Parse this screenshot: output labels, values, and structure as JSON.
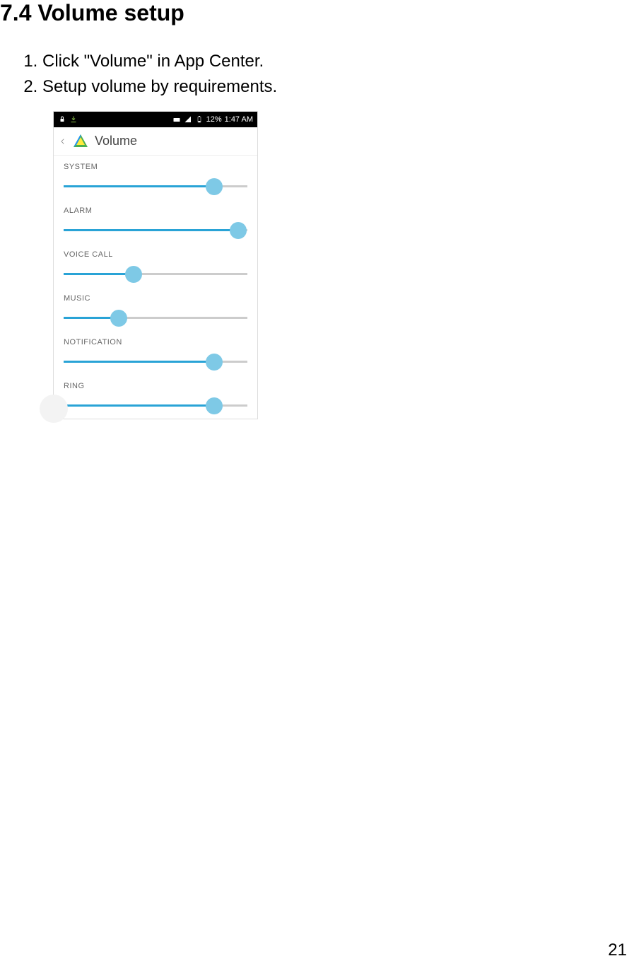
{
  "heading": "7.4 Volume setup",
  "steps": [
    "Click \"Volume\" in App Center.",
    "Setup volume by requirements."
  ],
  "screenshot": {
    "status_bar": {
      "battery_percent": "12%",
      "time": "1:47 AM"
    },
    "app_header": {
      "title": "Volume"
    },
    "sliders": [
      {
        "label": "SYSTEM",
        "percent": 82
      },
      {
        "label": "ALARM",
        "percent": 95
      },
      {
        "label": "VOICE CALL",
        "percent": 38
      },
      {
        "label": "MUSIC",
        "percent": 30
      },
      {
        "label": "NOTIFICATION",
        "percent": 82
      },
      {
        "label": "RING",
        "percent": 82
      }
    ]
  },
  "page_number": "21"
}
